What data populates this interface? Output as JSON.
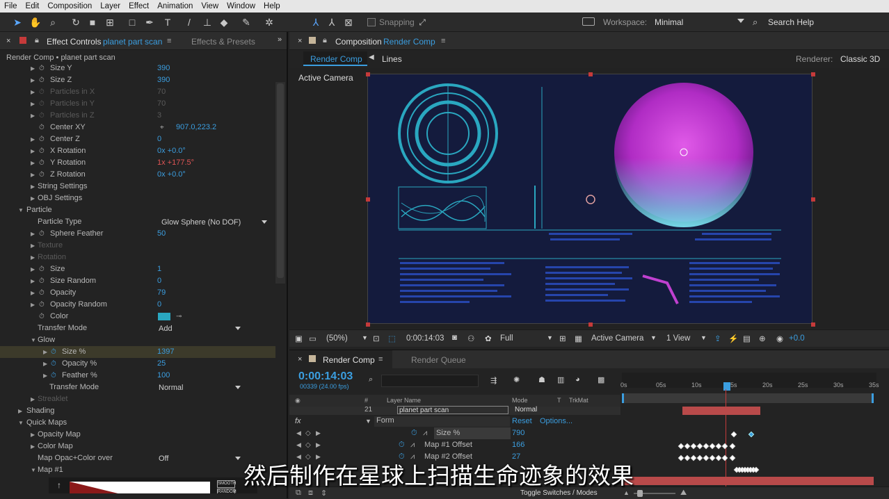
{
  "menu": [
    "File",
    "Edit",
    "Composition",
    "Layer",
    "Effect",
    "Animation",
    "View",
    "Window",
    "Help"
  ],
  "toolbar": {
    "snapping_label": "Snapping",
    "workspace_label": "Workspace:",
    "workspace_value": "Minimal",
    "search_label": "Search Help"
  },
  "effect_controls": {
    "tab_label": "Effect Controls",
    "tab_layer": "planet part scan",
    "tab2": "Effects & Presets",
    "breadcrumb": "Render Comp • planet part scan",
    "rows": [
      {
        "label": "Size Y",
        "value": "390",
        "indent": 1,
        "tri": true,
        "sw": true
      },
      {
        "label": "Size Z",
        "value": "390",
        "indent": 1,
        "tri": true,
        "sw": true
      },
      {
        "label": "Particles in X",
        "value": "70",
        "indent": 1,
        "tri": true,
        "sw": true,
        "disabled": true
      },
      {
        "label": "Particles in Y",
        "value": "70",
        "indent": 1,
        "tri": true,
        "sw": true,
        "disabled": true
      },
      {
        "label": "Particles in Z",
        "value": "3",
        "indent": 1,
        "tri": true,
        "sw": true,
        "disabled": true
      },
      {
        "label": "Center XY",
        "value": "907.0,223.2",
        "indent": 1,
        "tri": false,
        "sw": true,
        "target": true
      },
      {
        "label": "Center Z",
        "value": "0",
        "indent": 1,
        "tri": true,
        "sw": true
      },
      {
        "label": "X Rotation",
        "value": "0x +0.0°",
        "indent": 1,
        "tri": true,
        "sw": true
      },
      {
        "label": "Y Rotation",
        "value": "1x +177.5°",
        "indent": 1,
        "tri": true,
        "sw": true,
        "red": true
      },
      {
        "label": "Z Rotation",
        "value": "0x +0.0°",
        "indent": 1,
        "tri": true,
        "sw": true
      },
      {
        "label": "String Settings",
        "value": "",
        "indent": 0.5,
        "tri": true,
        "sw": false
      },
      {
        "label": "OBJ Settings",
        "value": "",
        "indent": 0.5,
        "tri": true,
        "sw": false
      },
      {
        "label": "Particle",
        "value": "",
        "indent": 0,
        "tri": true,
        "open": true,
        "sw": false
      },
      {
        "label": "Particle Type",
        "value": "Glow Sphere (No DOF)",
        "indent": 0.5,
        "tri": false,
        "sw": false,
        "dropdown": true
      },
      {
        "label": "Sphere Feather",
        "value": "50",
        "indent": 1,
        "tri": true,
        "sw": true
      },
      {
        "label": "Texture",
        "value": "",
        "indent": 0.5,
        "tri": true,
        "sw": false,
        "disabled": true
      },
      {
        "label": "Rotation",
        "value": "",
        "indent": 0.5,
        "tri": true,
        "sw": false,
        "disabled": true
      },
      {
        "label": "Size",
        "value": "1",
        "indent": 1,
        "tri": true,
        "sw": true
      },
      {
        "label": "Size Random",
        "value": "0",
        "indent": 1,
        "tri": true,
        "sw": true
      },
      {
        "label": "Opacity",
        "value": "79",
        "indent": 1,
        "tri": true,
        "sw": true
      },
      {
        "label": "Opacity Random",
        "value": "0",
        "indent": 1,
        "tri": true,
        "sw": true
      },
      {
        "label": "Color",
        "value": "",
        "indent": 1,
        "tri": false,
        "sw": true,
        "swatch": "#2aa7c0"
      },
      {
        "label": "Transfer Mode",
        "value": "Add",
        "indent": 0.5,
        "tri": false,
        "sw": false,
        "dropdown": true
      },
      {
        "label": "Glow",
        "value": "",
        "indent": 0.5,
        "tri": true,
        "open": true,
        "sw": false
      },
      {
        "label": "Size %",
        "value": "1397",
        "indent": 2,
        "tri": true,
        "sw": true,
        "selected": true
      },
      {
        "label": "Opacity %",
        "value": "25",
        "indent": 2,
        "tri": true,
        "sw": true
      },
      {
        "label": "Feather %",
        "value": "100",
        "indent": 2,
        "tri": true,
        "sw": true
      },
      {
        "label": "Transfer Mode",
        "value": "Normal",
        "indent": 1.5,
        "tri": false,
        "sw": false,
        "dropdown": true
      },
      {
        "label": "Streaklet",
        "value": "",
        "indent": 0.5,
        "tri": true,
        "sw": false,
        "disabled": true
      },
      {
        "label": "Shading",
        "value": "",
        "indent": 0,
        "tri": true,
        "sw": false
      },
      {
        "label": "Quick Maps",
        "value": "",
        "indent": 0,
        "tri": true,
        "open": true,
        "sw": false
      },
      {
        "label": "Opacity Map",
        "value": "",
        "indent": 0.5,
        "tri": true,
        "sw": false
      },
      {
        "label": "Color Map",
        "value": "",
        "indent": 0.5,
        "tri": true,
        "sw": false
      },
      {
        "label": "Map Opac+Color over",
        "value": "Off",
        "indent": 0.5,
        "tri": false,
        "sw": false,
        "dropdown": true
      },
      {
        "label": "Map #1",
        "value": "",
        "indent": 0.5,
        "tri": true,
        "open": true,
        "sw": false
      }
    ],
    "map_buttons": [
      "SMOOTH",
      "RANDOM"
    ]
  },
  "composition": {
    "tab_label": "Composition",
    "tab_name": "Render Comp",
    "subtabs": [
      "Render Comp",
      "Lines"
    ],
    "renderer_label": "Renderer:",
    "renderer_value": "Classic 3D",
    "camera_label": "Active Camera",
    "footer": {
      "zoom": "(50%)",
      "timecode": "0:00:14:03",
      "resolution": "Full",
      "camera": "Active Camera",
      "views": "1 View",
      "exposure": "+0.0"
    }
  },
  "timeline": {
    "tab_label": "Render Comp",
    "tab2": "Render Queue",
    "timecode": "0:00:14:03",
    "frames": "00339 (24.00 fps)",
    "ruler": [
      "0s",
      "05s",
      "10s",
      "15s",
      "20s",
      "25s",
      "30s",
      "35s"
    ],
    "columns": {
      "layer_name": "Layer Name",
      "mode": "Mode",
      "t": "T",
      "trkmat": "TrkMat",
      "num": "#"
    },
    "layer": {
      "num": "21",
      "name": "planet part scan",
      "mode": "Normal"
    },
    "form": {
      "label": "Form",
      "reset": "Reset",
      "options": "Options..."
    },
    "props": [
      {
        "name": "Size %",
        "value": "790"
      },
      {
        "name": "Map #1 Offset",
        "value": "166"
      },
      {
        "name": "Map #2 Offset",
        "value": "27"
      }
    ],
    "toggle_label": "Toggle Switches / Modes"
  },
  "subtitle": "然后制作在星球上扫描生命迹象的效果"
}
